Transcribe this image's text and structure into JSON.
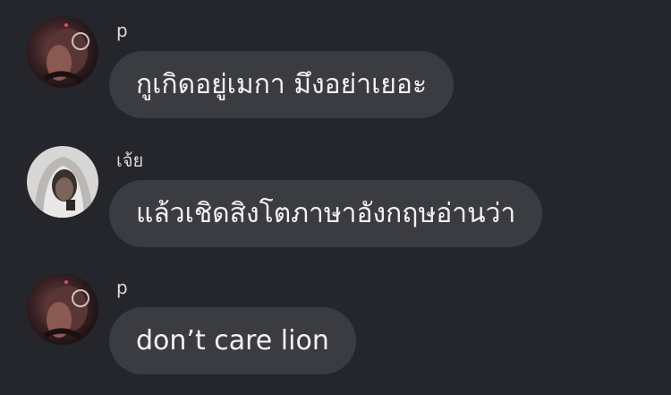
{
  "messages": [
    {
      "sender": "p",
      "avatar": "dark-selfie-avatar-icon",
      "text": "กูเกิดอยู่เมกา มึงอย่าเยอะ"
    },
    {
      "sender": "เจ้ย",
      "avatar": "hooded-person-avatar-icon",
      "text": "แล้วเชิดสิงโตภาษาอังกฤษอ่านว่า"
    },
    {
      "sender": "p",
      "avatar": "dark-selfie-avatar-icon",
      "text": "don’t care lion"
    }
  ],
  "colors": {
    "background": "#25262b",
    "bubble": "#3b3c41",
    "text": "#f2f2f4",
    "sender": "#d9d9dc"
  }
}
